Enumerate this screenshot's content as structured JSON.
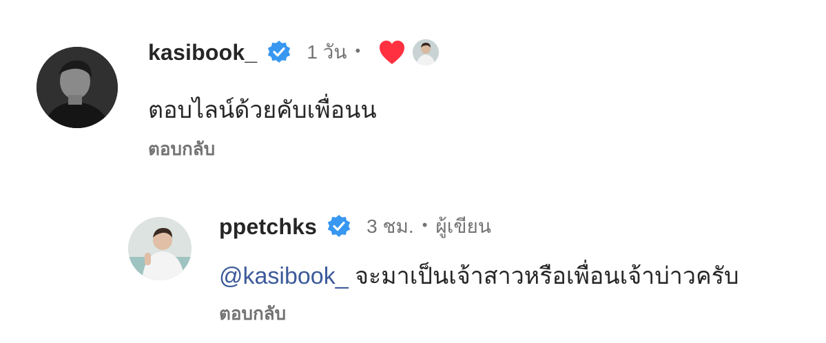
{
  "comments": [
    {
      "username": "kasibook_",
      "time": "1 วัน",
      "separator": "•",
      "text": "ตอบไลน์ด้วยคับเพื่อนน",
      "reply_label": "ตอบกลับ",
      "liked_by_author": true
    },
    {
      "username": "ppetchks",
      "time": "3 ชม.",
      "separator": "•",
      "author_tag": "ผู้เขียน",
      "mention": "@kasibook_",
      "text": "จะมาเป็นเจ้าสาวหรือเพื่อนเจ้าบ่าวครับ",
      "reply_label": "ตอบกลับ"
    }
  ],
  "colors": {
    "verified_badge": "#3897f0",
    "heart": "#ff3040",
    "mention": "#3c5a9a",
    "secondary_text": "#737373"
  },
  "icons": {
    "verified": "verified-badge-icon",
    "heart": "heart-icon"
  }
}
